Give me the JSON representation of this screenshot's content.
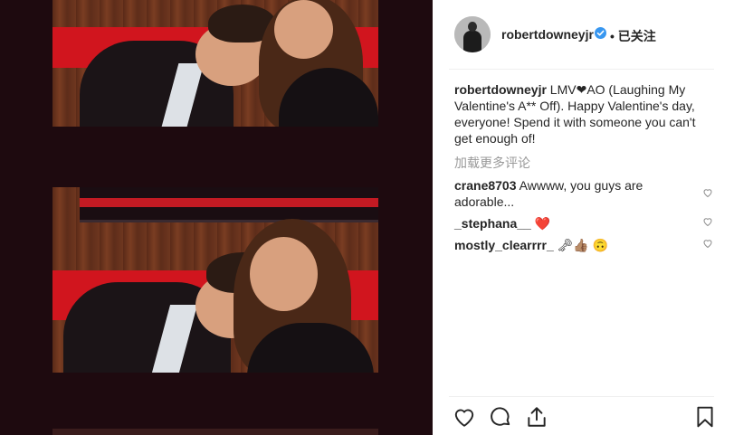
{
  "post": {
    "username": "robertdowneyjr",
    "follow_label": "• 已关注",
    "caption_user": "robertdowneyjr",
    "caption_text": "LMV❤AO (Laughing My Valentine's A** Off). Happy Valentine's day, everyone! Spend it with someone you can't get enough of!",
    "load_more": "加载更多评论"
  },
  "comments": [
    {
      "user": "crane8703",
      "text": "Awwww, you guys are adorable..."
    },
    {
      "user": "_stephana__",
      "text": "❤️"
    },
    {
      "user": "mostly_clearrrr_",
      "text": "🗝👍🏽 🙃"
    }
  ],
  "colors": {
    "verified": "#3897f0",
    "heart_red": "#ed1c24",
    "media_bg": "#1e0a0f",
    "sofa_red": "#d1151e"
  },
  "icons": {
    "like": "heart-outline-icon",
    "comment": "speech-bubble-icon",
    "share": "share-upload-icon",
    "save": "bookmark-icon",
    "comment_like": "heart-outline-small-icon"
  }
}
